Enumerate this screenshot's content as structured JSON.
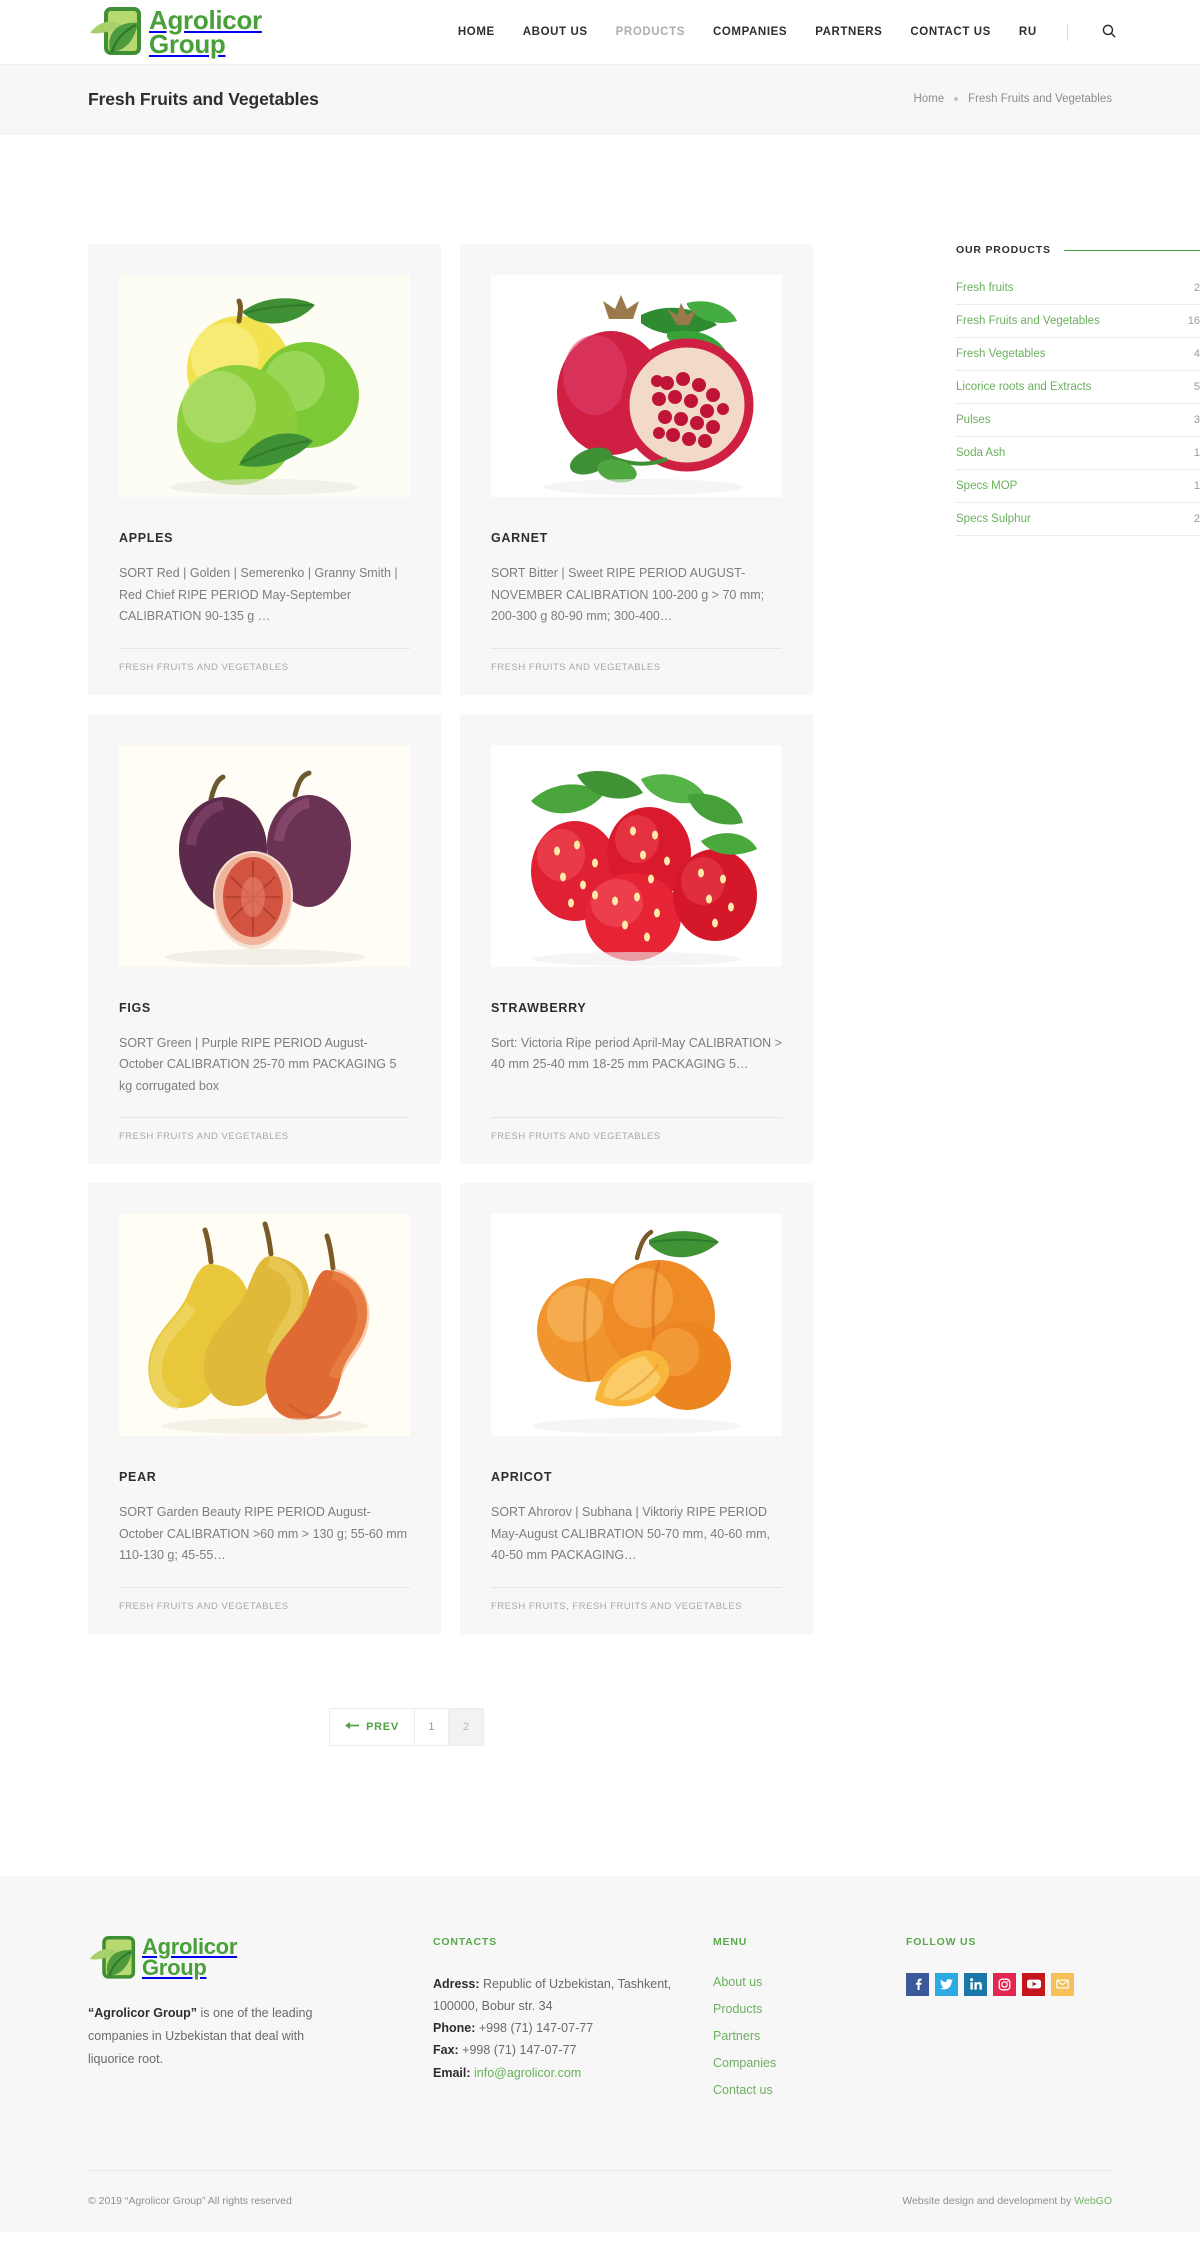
{
  "brand": {
    "name_line1": "Agrolicor",
    "name_line2": "Group",
    "green": "#49a03a",
    "leaf_light": "#a8d06a",
    "leaf_dark": "#3f8f35"
  },
  "nav": {
    "items": [
      {
        "label": "HOME",
        "active": false
      },
      {
        "label": "ABOUT US",
        "active": false
      },
      {
        "label": "PRODUCTS",
        "active": true
      },
      {
        "label": "COMPANIES",
        "active": false
      },
      {
        "label": "PARTNERS",
        "active": false
      },
      {
        "label": "CONTACT US",
        "active": false
      },
      {
        "label": "RU",
        "active": false
      }
    ],
    "search_icon": "search-icon"
  },
  "titlebar": {
    "title": "Fresh Fruits and Vegetables",
    "breadcrumb_home": "Home",
    "breadcrumb_current": "Fresh Fruits and Vegetables"
  },
  "products": [
    {
      "title": "APPLES",
      "desc": "SORT Red | Golden | Semerenko | Granny Smith | Red Chief RIPE PERIOD May-September CALIBRATION 90-135 g  …",
      "cats": "FRESH FRUITS AND VEGETABLES",
      "image": "apples-photo"
    },
    {
      "title": "GARNET",
      "desc": "SORT Bitter | Sweet RIPE PERIOD AUGUST-NOVEMBER CALIBRATION 100-200 g > 70 mm; 200-300 g 80-90 mm; 300-400…",
      "cats": "FRESH FRUITS AND VEGETABLES",
      "image": "pomegranate-photo"
    },
    {
      "title": "FIGS",
      "desc": "SORT Green | Purple RIPE PERIOD August-October CALIBRATION 25-70 mm PACKAGING 5 kg corrugated box",
      "cats": "FRESH FRUITS AND VEGETABLES",
      "image": "figs-photo"
    },
    {
      "title": "STRAWBERRY",
      "desc": "Sort: Victoria Ripe period April-May CALIBRATION > 40 mm 25-40 mm 18-25 mm PACKAGING 5…",
      "cats": "FRESH FRUITS AND VEGETABLES",
      "image": "strawberry-photo"
    },
    {
      "title": "PEAR",
      "desc": "SORT Garden Beauty RIPE PERIOD August-October CALIBRATION >60 mm > 130 g; 55-60 mm 110-130 g; 45-55…",
      "cats": "FRESH FRUITS AND VEGETABLES",
      "image": "pears-photo"
    },
    {
      "title": "APRICOT",
      "desc": "SORT Ahrorov | Subhana | Viktoriy RIPE PERIOD May-August CALIBRATION 50-70 mm, 40-60 mm, 40-50 mm PACKAGING…",
      "cats": "FRESH FRUITS, FRESH FRUITS AND VEGETABLES",
      "image": "apricot-photo"
    }
  ],
  "sidebar": {
    "heading": "OUR PRODUCTS",
    "items": [
      {
        "label": "Fresh fruits",
        "count": "2"
      },
      {
        "label": "Fresh Fruits and Vegetables",
        "count": "16"
      },
      {
        "label": "Fresh Vegetables",
        "count": "4"
      },
      {
        "label": "Licorice roots and Extracts",
        "count": "5"
      },
      {
        "label": "Pulses",
        "count": "3"
      },
      {
        "label": "Soda Ash",
        "count": "1"
      },
      {
        "label": "Specs MOP",
        "count": "1"
      },
      {
        "label": "Specs Sulphur",
        "count": "2"
      }
    ]
  },
  "pagination": {
    "prev_label": "PREV",
    "pages": [
      {
        "label": "1",
        "current": false
      },
      {
        "label": "2",
        "current": true
      }
    ]
  },
  "footer": {
    "about_text_bold": "“Agrolicor Group”",
    "about_text_rest": " is one of the leading companies in Uzbekistan that deal with liquorice root.",
    "contacts_heading": "CONTACTS",
    "address_label": "Adress:",
    "address_value": " Republic of Uzbekistan, Tashkent, 100000, Bobur str. 34",
    "phone_label": "Phone:",
    "phone_value": " +998 (71) 147-07-77",
    "fax_label": "Fax:",
    "fax_value": " +998 (71) 147-07-77",
    "email_label": "Email:",
    "email_value": "info@agrolicor.com",
    "menu_heading": "MENU",
    "menu_items": [
      {
        "label": "About us"
      },
      {
        "label": "Products"
      },
      {
        "label": "Partners"
      },
      {
        "label": "Companies"
      },
      {
        "label": "Contact us"
      }
    ],
    "follow_heading": "FOLLOW US",
    "socials": [
      {
        "name": "facebook-icon",
        "color": "#3b5998"
      },
      {
        "name": "twitter-icon",
        "color": "#2cabe3"
      },
      {
        "name": "linkedin-icon",
        "color": "#1a77a8"
      },
      {
        "name": "instagram-icon",
        "color": "#e4254f"
      },
      {
        "name": "youtube-icon",
        "color": "#c4161c"
      },
      {
        "name": "email-icon",
        "color": "#f7c15a"
      }
    ],
    "copyright": "© 2019 “Agrolicor Group” All rights reserved",
    "credit_text": "Website design and development by",
    "credit_link": "WebGO"
  }
}
